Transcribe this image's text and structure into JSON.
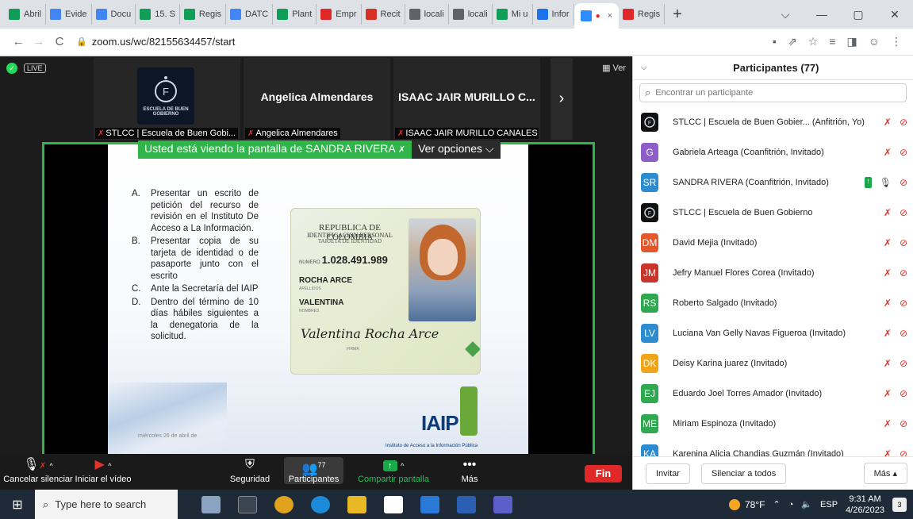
{
  "browser": {
    "tabs": [
      {
        "label": "Abril",
        "color": "#0f9d58"
      },
      {
        "label": "Evide",
        "color": "#4285f4"
      },
      {
        "label": "Docu",
        "color": "#4285f4"
      },
      {
        "label": "15. S",
        "color": "#0f9d58"
      },
      {
        "label": "Regis",
        "color": "#0f9d58"
      },
      {
        "label": "DATC",
        "color": "#4285f4"
      },
      {
        "label": "Plant",
        "color": "#0f9d58"
      },
      {
        "label": "Empr",
        "color": "#e02828"
      },
      {
        "label": "Recit",
        "color": "#d93025"
      },
      {
        "label": "locali",
        "color": "#5f6368"
      },
      {
        "label": "locali",
        "color": "#5f6368"
      },
      {
        "label": "Mi u",
        "color": "#0f9d58"
      },
      {
        "label": "Infor",
        "color": "#1a73e8"
      }
    ],
    "active_tab_close": "×",
    "after_tab": {
      "label": "Regis",
      "color": "#e02828"
    },
    "new_tab": "+",
    "window_controls": [
      "⌵",
      "—",
      "▢",
      "✕"
    ],
    "url": "zoom.us/wc/82155634457/start"
  },
  "meeting": {
    "live_badge": "LIVE",
    "view_label": "Ver",
    "thumbnails": [
      {
        "name": "",
        "caption": "STLCC | Escuela de Buen Gobi...",
        "logo": "ESCUELA DE BUEN GOBIERNO"
      },
      {
        "name": "Angelica Almendares",
        "caption": "Angelica Almendares"
      },
      {
        "name": "ISAAC JAIR MURILLO C...",
        "caption": "ISAAC JAIR MURILLO CANALES"
      }
    ],
    "next_arrow": "›",
    "share_banner": "Usted está viendo la pantalla de SANDRA RIVERA",
    "view_options": "Ver opciones ⌵",
    "slide": {
      "items": [
        {
          "letter": "A.",
          "text": "Presentar un escrito de petición del recurso de revisión en el Instituto De Acceso a La Información."
        },
        {
          "letter": "B.",
          "text": "Presentar copia de su tarjeta de identidad o de pasaporte junto con el escrito"
        },
        {
          "letter": "C.",
          "text": "Ante la Secretaría del IAIP"
        },
        {
          "letter": "D.",
          "text": "Dentro del término de 10 días hábiles siguientes a la denegatoria de la solicitud."
        }
      ],
      "card": {
        "country": "REPUBLICA DE COLOMBIA",
        "type": "IDENTIFICACION PERSONAL",
        "subtype": "TARJETA DE IDENTIDAD",
        "number_label": "NUMERO",
        "number": "1.028.491.989",
        "surname": "ROCHA ARCE",
        "surname_label": "APELLIDOS",
        "given": "VALENTINA",
        "given_label": "NOMBRES",
        "signature": "Valentina Rocha Arce",
        "sign_label": "FIRMA"
      },
      "logo": "IAIP",
      "footer": "Instituto de Acceso a la Información Pública",
      "date": "miércoles 26 de abril de"
    },
    "toolbar": {
      "mute_label": "Cancelar silenciar",
      "video_label": "Iniciar el vídeo",
      "security_label": "Seguridad",
      "participants_label": "Participantes",
      "participants_count": "77",
      "share_label": "Compartir pantalla",
      "more_label": "Más",
      "more_icon": "•••",
      "end_label": "Fin"
    }
  },
  "panel": {
    "title": "Participantes (77)",
    "search_placeholder": "Encontrar un participante",
    "participants": [
      {
        "initials": "",
        "name": "STLCC | Escuela de Buen Gobier... (Anfitrión, Yo)",
        "color": "#111111",
        "logo": true,
        "sharing": false
      },
      {
        "initials": "G",
        "name": "Gabriela Arteaga (Coanfitrión, Invitado)",
        "color": "#8e5ec8",
        "logo": false,
        "sharing": false
      },
      {
        "initials": "SR",
        "name": "SANDRA RIVERA (Coanfitrión, Invitado)",
        "color": "#2d8ccf",
        "logo": false,
        "sharing": true
      },
      {
        "initials": "",
        "name": "STLCC | Escuela de Buen Gobierno",
        "color": "#111111",
        "logo": true,
        "sharing": false
      },
      {
        "initials": "DM",
        "name": "David Mejia (Invitado)",
        "color": "#e2582c",
        "logo": false,
        "sharing": false
      },
      {
        "initials": "JM",
        "name": "Jefry Manuel Flores Corea (Invitado)",
        "color": "#c9352c",
        "logo": false,
        "sharing": false
      },
      {
        "initials": "RS",
        "name": "Roberto Salgado (Invitado)",
        "color": "#2fa84f",
        "logo": false,
        "sharing": false
      },
      {
        "initials": "LV",
        "name": "Luciana Van Gelly Navas Figueroa (Invitado)",
        "color": "#2d8ccf",
        "logo": false,
        "sharing": false
      },
      {
        "initials": "DK",
        "name": "Deisy Karina juarez (Invitado)",
        "color": "#f0a418",
        "logo": false,
        "sharing": false
      },
      {
        "initials": "EJ",
        "name": "Eduardo Joel Torres Amador (Invitado)",
        "color": "#2fa84f",
        "logo": false,
        "sharing": false
      },
      {
        "initials": "ME",
        "name": "Miriam Espinoza (Invitado)",
        "color": "#2fa84f",
        "logo": false,
        "sharing": false
      },
      {
        "initials": "KA",
        "name": "Karenina Alicia Chandias Guzmán (Invitado)",
        "color": "#2d8ccf",
        "logo": false,
        "sharing": false
      }
    ],
    "invite_label": "Invitar",
    "mute_all_label": "Silenciar a todos",
    "more_label": "Más ▴"
  },
  "taskbar": {
    "search_placeholder": "Type here to search",
    "temperature": "78°F",
    "language": "ESP",
    "time": "9:31 AM",
    "date": "4/26/2023",
    "notifications": "3"
  }
}
